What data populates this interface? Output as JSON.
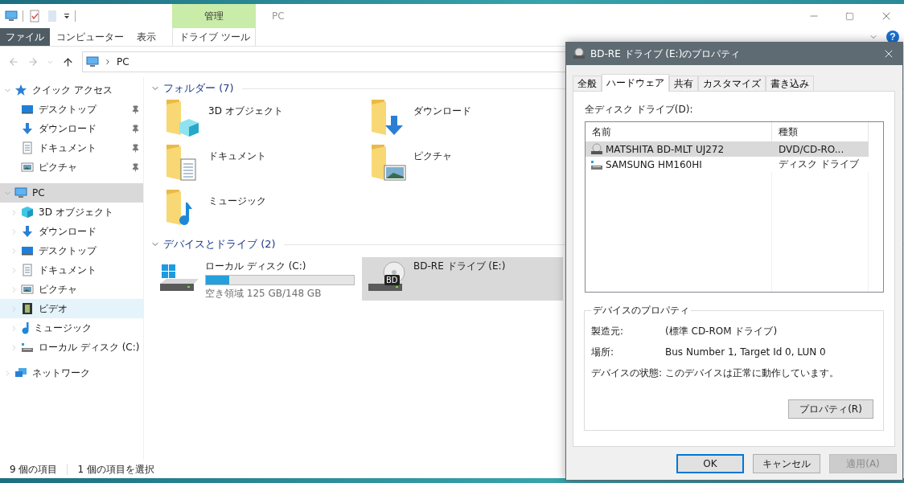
{
  "title_bar": {
    "context_tab": "管理",
    "title": "PC",
    "help_button": "?"
  },
  "ribbon_tabs": [
    {
      "label": "ファイル",
      "kind": "file"
    },
    {
      "label": "コンピューター",
      "kind": "tab"
    },
    {
      "label": "表示",
      "kind": "tab"
    },
    {
      "label": "ドライブ ツール",
      "kind": "context"
    }
  ],
  "address_bar": {
    "path": "PC"
  },
  "sidebar": {
    "items": [
      {
        "label": "クイック アクセス",
        "kind": "star",
        "expanded": true,
        "selected": false,
        "hovered": false,
        "children": [
          {
            "label": "デスクトップ",
            "kind": "desktop",
            "pinned": true,
            "selected": false,
            "hovered": false
          },
          {
            "label": "ダウンロード",
            "kind": "download",
            "pinned": true,
            "selected": false,
            "hovered": false
          },
          {
            "label": "ドキュメント",
            "kind": "document",
            "pinned": true,
            "selected": false,
            "hovered": false
          },
          {
            "label": "ピクチャ",
            "kind": "picture",
            "pinned": true,
            "selected": false,
            "hovered": false
          }
        ]
      },
      {
        "label": "PC",
        "kind": "pc",
        "expanded": true,
        "selected": true,
        "hovered": false,
        "children": [
          {
            "label": "3D オブジェクト",
            "kind": "cube",
            "expanded": false,
            "selected": false,
            "hovered": false
          },
          {
            "label": "ダウンロード",
            "kind": "download",
            "expanded": false,
            "selected": false,
            "hovered": false
          },
          {
            "label": "デスクトップ",
            "kind": "desktop",
            "expanded": false,
            "selected": false,
            "hovered": false
          },
          {
            "label": "ドキュメント",
            "kind": "document",
            "expanded": false,
            "selected": false,
            "hovered": false
          },
          {
            "label": "ピクチャ",
            "kind": "picture",
            "expanded": false,
            "selected": false,
            "hovered": false
          },
          {
            "label": "ビデオ",
            "kind": "video",
            "expanded": false,
            "selected": false,
            "hovered": true
          },
          {
            "label": "ミュージック",
            "kind": "music",
            "expanded": false,
            "selected": false,
            "hovered": false
          },
          {
            "label": "ローカル ディスク (C:)",
            "kind": "disk",
            "expanded": false,
            "selected": false,
            "hovered": false
          }
        ]
      },
      {
        "label": "ネットワーク",
        "kind": "network",
        "expanded": false,
        "selected": false,
        "hovered": false
      }
    ]
  },
  "content": {
    "folders": {
      "title": "フォルダー (7)",
      "expanded": true,
      "items": [
        {
          "name": "3D オブジェクト",
          "kind": "cube"
        },
        {
          "name": "ダウンロード",
          "kind": "download"
        },
        {
          "name": "ドキュメント",
          "kind": "document"
        },
        {
          "name": "ピクチャ",
          "kind": "picture"
        },
        {
          "name": "ミュージック",
          "kind": "music"
        }
      ]
    },
    "drives": {
      "title": "デバイスとドライブ (2)",
      "expanded": true,
      "items": [
        {
          "name": "ローカル ディスク (C:)",
          "kind": "disk",
          "level": 0.155,
          "free": "空き領域 125 GB/148 GB",
          "selected": false
        },
        {
          "name": "BD-RE ドライブ (E:)",
          "kind": "optical",
          "badge": "BD",
          "selected": true
        }
      ]
    }
  },
  "status_bar": {
    "item_count": "9 個の項目",
    "selection": "1 個の項目を選択"
  },
  "dialog": {
    "title": "BD-RE ドライブ (E:)のプロパティ",
    "tabs": [
      {
        "label": "全般",
        "selected": false
      },
      {
        "label": "ハードウェア",
        "selected": true
      },
      {
        "label": "共有",
        "selected": false
      },
      {
        "label": "カスタマイズ",
        "selected": false
      },
      {
        "label": "書き込み",
        "selected": false
      }
    ],
    "list_label": "全ディスク ドライブ(D):",
    "columns": [
      "名前",
      "種類"
    ],
    "rows": [
      {
        "name": "MATSHITA BD-MLT UJ272",
        "type": "DVD/CD-RO...",
        "kind": "optical",
        "selected": true
      },
      {
        "name": "SAMSUNG HM160HI",
        "type": "ディスク ドライブ",
        "kind": "disk",
        "selected": false
      }
    ],
    "group_title": "デバイスのプロパティ",
    "properties": [
      {
        "label": "製造元:",
        "value": "(標準 CD-ROM ドライブ)"
      },
      {
        "label": "場所:",
        "value": "Bus Number 1, Target Id 0, LUN 0"
      },
      {
        "label": "デバイスの状態:",
        "value": "このデバイスは正常に動作しています。"
      }
    ],
    "properties_button": "プロパティ(R)",
    "buttons": [
      {
        "label": "OK",
        "default": true,
        "disabled": false
      },
      {
        "label": "キャンセル",
        "default": false,
        "disabled": false
      },
      {
        "label": "適用(A)",
        "default": false,
        "disabled": true
      }
    ]
  }
}
